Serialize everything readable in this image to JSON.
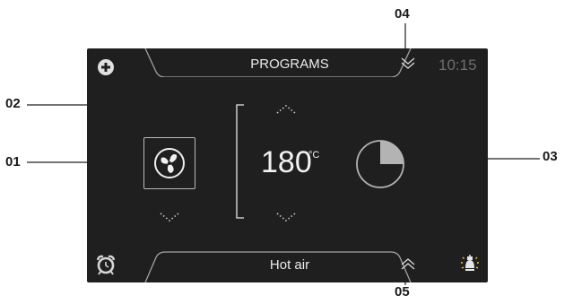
{
  "callouts": {
    "c01": "01",
    "c02": "02",
    "c03": "03",
    "c04": "04",
    "c05": "05"
  },
  "header": {
    "title": "PROGRAMS",
    "clock": "10:15"
  },
  "main": {
    "temperature": "180",
    "temperature_unit": "°C",
    "timer_fraction": 0.25
  },
  "footer": {
    "mode_label": "Hot air"
  },
  "icons": {
    "top_left": "plus-circle-icon",
    "fan": "fan-icon",
    "alarm": "alarm-clock-icon",
    "light": "oven-light-icon",
    "expand_down": "chevron-down-double-icon",
    "expand_up": "chevron-up-double-icon"
  },
  "colors": {
    "screen_bg": "#1f1f1f",
    "text": "#f2f2f2",
    "dim_text": "#6e6e6e",
    "accent_grey": "#b0b0b0"
  }
}
